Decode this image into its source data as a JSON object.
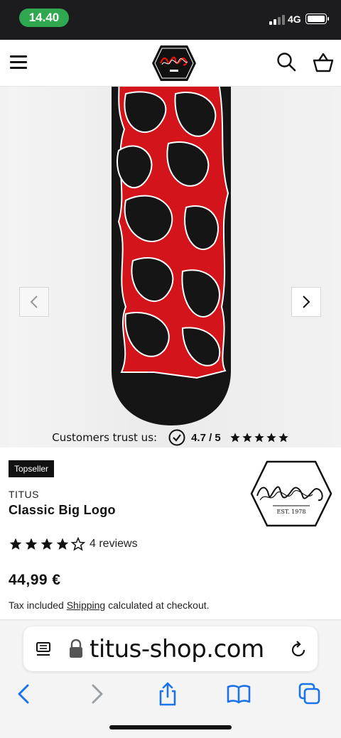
{
  "status_bar": {
    "time": "14.40",
    "network": "4G"
  },
  "header": {
    "logo_name": "titus-logo",
    "icons": [
      "menu-icon",
      "search-icon",
      "cart-icon"
    ]
  },
  "gallery": {
    "trust_text": "Customers trust us:",
    "rating": "4.7 / 5",
    "trust_stars": 5
  },
  "product": {
    "badge": "Topseller",
    "vendor": "TITUS",
    "title": "Classic Big Logo",
    "rating": 4,
    "max_rating": 5,
    "review_count": "4 reviews",
    "price": "44,99 €",
    "tax_prefix": "Tax included",
    "shipping_link": "Shipping",
    "tax_suffix": "calculated at checkout."
  },
  "browser": {
    "url": "titus-shop.com",
    "accent_color": "#1a73e8"
  },
  "colors": {
    "status_pill": "#2fa84f",
    "deck_red": "#d4141b"
  }
}
